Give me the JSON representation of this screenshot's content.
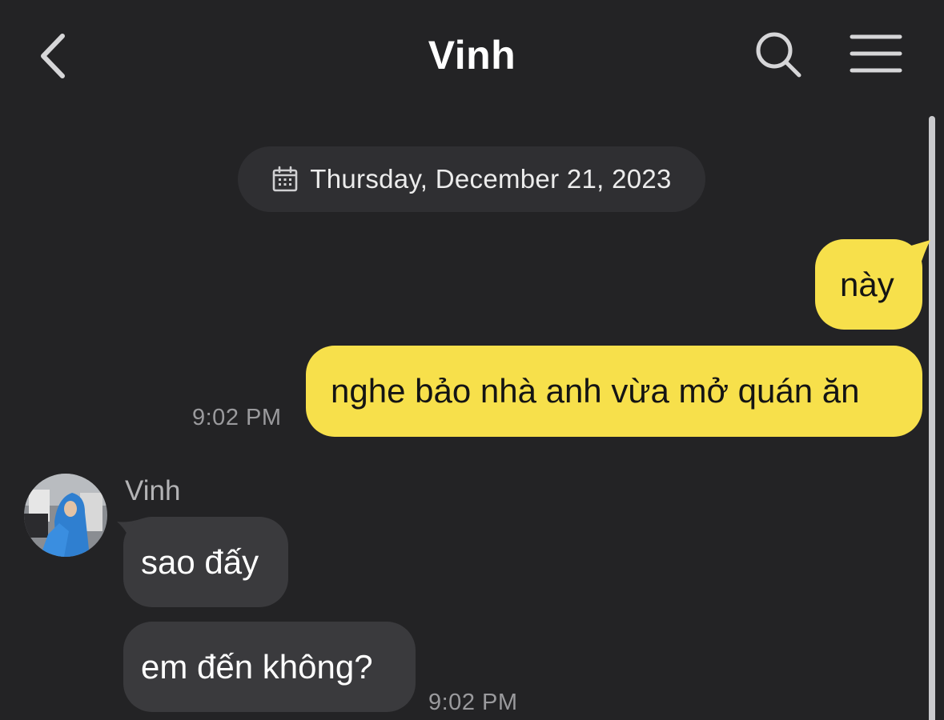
{
  "header": {
    "title": "Vinh",
    "back_icon": "chevron-left-icon",
    "search_icon": "search-icon",
    "menu_icon": "menu-icon"
  },
  "date_divider": {
    "icon": "calendar-icon",
    "text": "Thursday, December 21, 2023"
  },
  "messages": [
    {
      "direction": "outgoing",
      "text": "này"
    },
    {
      "direction": "outgoing",
      "text": "nghe bảo nhà anh vừa mở quán ăn",
      "time": "9:02 PM"
    },
    {
      "direction": "incoming",
      "sender": "Vinh",
      "text": "sao đấy"
    },
    {
      "direction": "incoming",
      "text": "em đến không?",
      "time": "9:02 PM"
    }
  ],
  "colors": {
    "background": "#232325",
    "outgoing_bubble": "#f7e04b",
    "incoming_bubble": "#3a3a3d",
    "date_pill": "#2f2f32"
  }
}
